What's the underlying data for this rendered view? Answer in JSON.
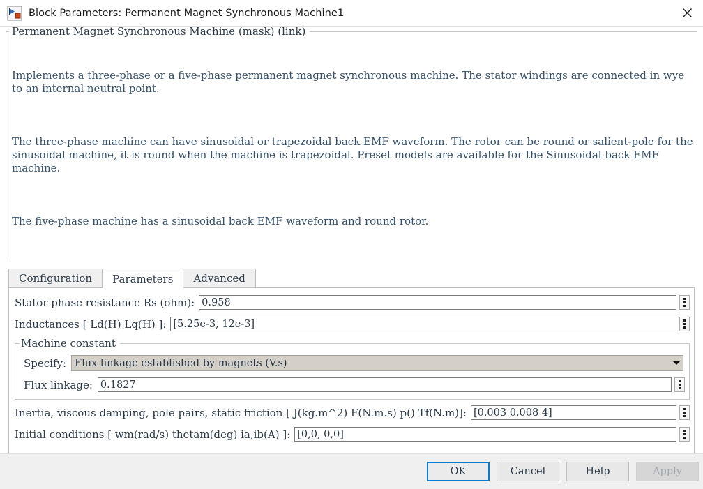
{
  "window": {
    "title": "Block Parameters: Permanent Magnet Synchronous Machine1",
    "icon": "simulink-block-icon",
    "close_label": "close-icon"
  },
  "description": {
    "legend": "Permanent Magnet Synchronous Machine (mask) (link)",
    "paragraphs": [
      "Implements a three-phase or a five-phase permanent magnet synchronous machine. The stator windings are connected in wye to an internal neutral point.",
      "The three-phase machine can have sinusoidal or trapezoidal back EMF waveform. The rotor can be round or salient-pole for the sinusoidal machine, it is round when the machine is trapezoidal. Preset models are available for the Sinusoidal back EMF machine.",
      "The five-phase machine has a sinusoidal back EMF waveform and round rotor."
    ]
  },
  "tabs": [
    {
      "label": "Configuration",
      "active": false
    },
    {
      "label": "Parameters",
      "active": true
    },
    {
      "label": "Advanced",
      "active": false
    }
  ],
  "fields": {
    "stator_resistance": {
      "label": "Stator phase resistance Rs (ohm):",
      "value": "0.958"
    },
    "inductances": {
      "label": "Inductances [ Ld(H) Lq(H) ]:",
      "value": "[5.25e-3, 12e-3]"
    },
    "inertia": {
      "label": "Inertia, viscous damping, pole pairs, static friction [ J(kg.m^2)  F(N.m.s)  p()  Tf(N.m)]:",
      "value": "[0.003 0.008 4]"
    },
    "initial_conditions": {
      "label": "Initial conditions [ wm(rad/s)  thetam(deg)  ia,ib(A) ]:",
      "value": "[0,0, 0,0]"
    }
  },
  "machine_constant": {
    "legend": "Machine constant",
    "specify_label": "Specify:",
    "specify_value": "Flux linkage established by magnets (V.s)",
    "flux_label": "Flux linkage:",
    "flux_value": "0.1827"
  },
  "buttons": {
    "ok": "OK",
    "cancel": "Cancel",
    "help": "Help",
    "apply": "Apply"
  },
  "colors": {
    "accent": "#0a7cd4",
    "text": "#2b3a4a",
    "panel": "#ffffff",
    "chrome": "#f0f0f0",
    "combo_bg": "#d4d0c8"
  }
}
